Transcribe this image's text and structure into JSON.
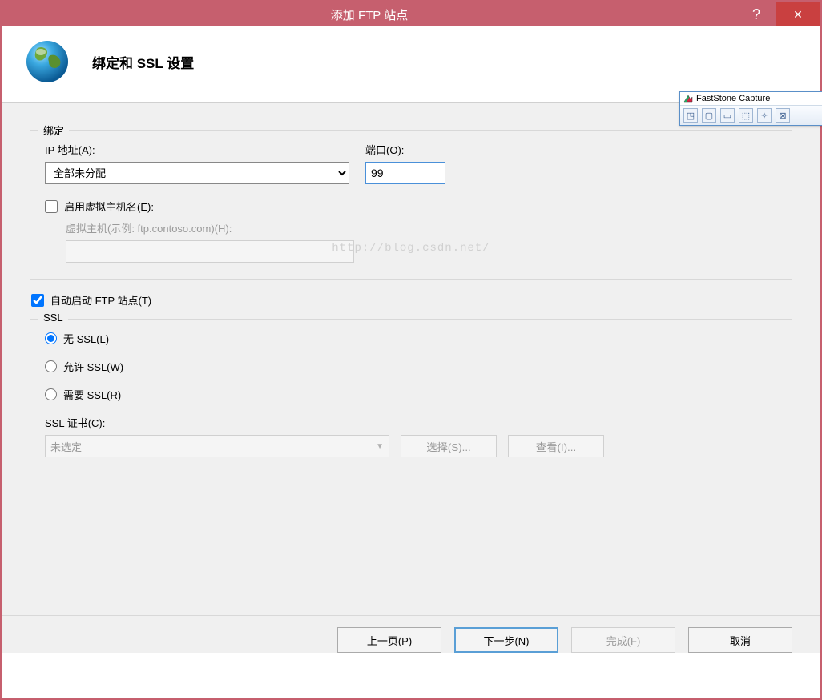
{
  "window": {
    "title": "添加 FTP 站点",
    "help": "?",
    "close": "✕"
  },
  "header": {
    "title": "绑定和 SSL 设置"
  },
  "binding": {
    "legend": "绑定",
    "ip_label": "IP 地址(A):",
    "ip_value": "全部未分配",
    "port_label": "端口(O):",
    "port_value": "99",
    "enable_vhost_label": "启用虚拟主机名(E):",
    "enable_vhost_checked": false,
    "vhost_placeholder": "虚拟主机(示例: ftp.contoso.com)(H):"
  },
  "autostart": {
    "label": "自动启动 FTP 站点(T)",
    "checked": true
  },
  "ssl": {
    "legend": "SSL",
    "options": [
      {
        "label": "无 SSL(L)",
        "value": "none"
      },
      {
        "label": "允许 SSL(W)",
        "value": "allow"
      },
      {
        "label": "需要 SSL(R)",
        "value": "require"
      }
    ],
    "selected": "none",
    "cert_label": "SSL 证书(C):",
    "cert_value": "未选定",
    "select_btn": "选择(S)...",
    "view_btn": "查看(I)..."
  },
  "buttons": {
    "prev": "上一页(P)",
    "next": "下一步(N)",
    "finish": "完成(F)",
    "cancel": "取消"
  },
  "watermark": "http://blog.csdn.net/",
  "faststone": {
    "title": "FastStone Capture"
  }
}
